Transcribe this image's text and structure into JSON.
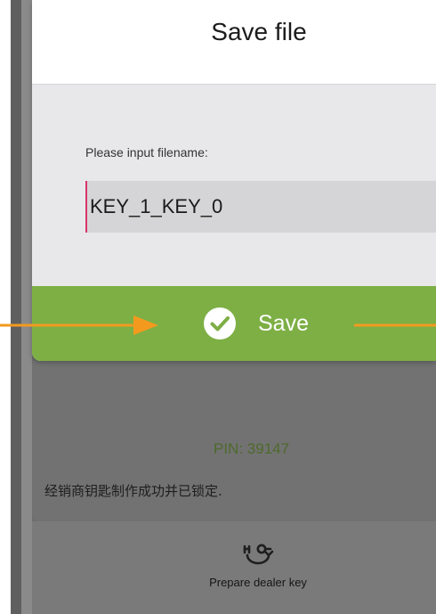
{
  "dialog": {
    "title": "Save file",
    "prompt": "Please input filename:",
    "filename_value": "KEY_1_KEY_0",
    "save_label": "Save"
  },
  "background": {
    "pin": "PIN: 39147",
    "status": "经销商钥匙制作成功并已锁定.",
    "dealer_key_label": "Prepare dealer key"
  },
  "icons": {
    "save": "check-circle-icon",
    "dealer_key": "key-refresh-icon",
    "annotation": "arrow-icon"
  },
  "colors": {
    "save_button": "#7daf45",
    "annotation_arrow": "#f39a1e",
    "pin_text": "#4e6a2c"
  }
}
